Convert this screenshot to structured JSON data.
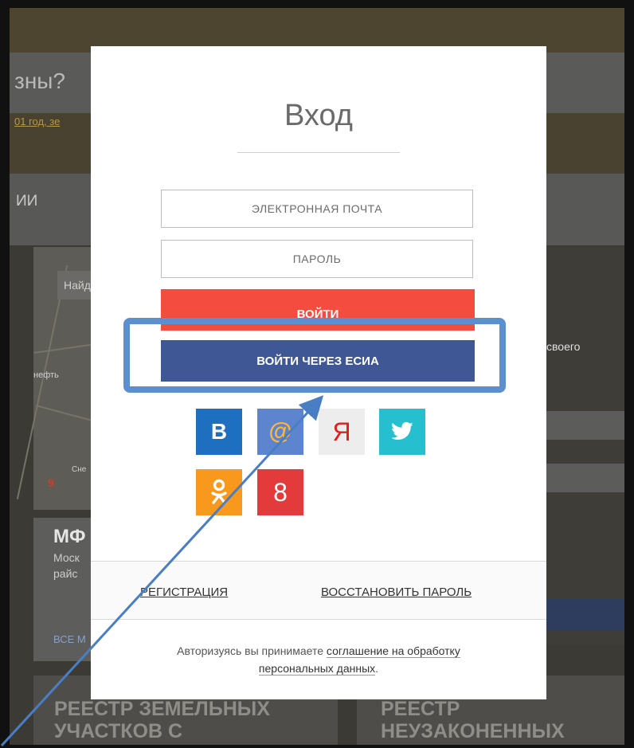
{
  "background": {
    "question_text": "зны?",
    "link_text": "01 год, зе",
    "section_partial": "ИИ",
    "map_search": "Найд",
    "map_oil": "нефть",
    "map_town": "Сне",
    "mfc_title": "МФ",
    "mfc_text_1": "Моск",
    "mfc_text_2": "райс",
    "all_link": "ВСЕ М",
    "right_text": "к своего",
    "tile1_line1": "РЕЕСТР ЗЕМЕЛЬНЫХ",
    "tile1_line2": "УЧАСТКОВ С",
    "tile2_line1": "РЕЕСТР",
    "tile2_line2": "НЕУЗАКОНЕННЫХ"
  },
  "modal": {
    "title": "Вход",
    "email_placeholder": "ЭЛЕКТРОННАЯ ПОЧТА",
    "password_placeholder": "ПАРОЛЬ",
    "login_button": "ВОЙТИ",
    "esia_button": "ВОЙТИ ЧЕРЕЗ ЕСИА",
    "socials": {
      "vk": "B",
      "mail": "@",
      "yandex": "Я",
      "twitter": "🐦",
      "ok": "ок",
      "google": "8"
    },
    "register_link": "РЕГИСТРАЦИЯ",
    "restore_link": "ВОССТАНОВИТЬ ПАРОЛЬ",
    "consent_prefix": "Авторизуясь вы принимаете ",
    "consent_link": "соглашение на обработку персональных данных",
    "consent_suffix": "."
  },
  "colors": {
    "login": "#f44c3f",
    "esia": "#3f5895",
    "highlight": "#5b8fd0"
  }
}
